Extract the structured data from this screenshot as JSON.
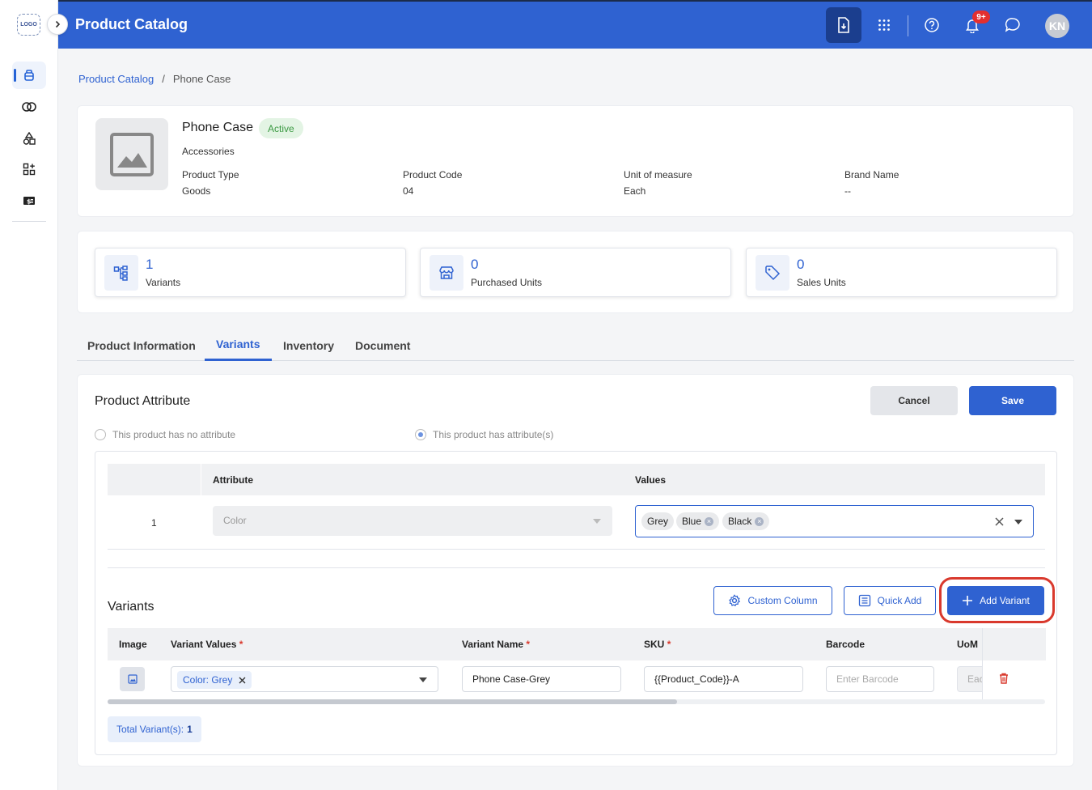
{
  "sidebar": {
    "logo_text": "LOGO",
    "items": [
      {
        "icon": "product-box-icon",
        "active": true
      },
      {
        "icon": "rings-icon",
        "active": false
      },
      {
        "icon": "shapes-icon",
        "active": false
      },
      {
        "icon": "grid-add-icon",
        "active": false
      },
      {
        "icon": "money-icon",
        "active": false
      }
    ]
  },
  "header": {
    "title": "Product Catalog",
    "notification_count": "9+",
    "avatar_initials": "KN"
  },
  "breadcrumb": {
    "parent": "Product Catalog",
    "separator": "/",
    "current": "Phone Case"
  },
  "product": {
    "name": "Phone Case",
    "status": "Active",
    "category": "Accessories",
    "meta": [
      {
        "label": "Product Type",
        "value": "Goods"
      },
      {
        "label": "Product Code",
        "value": "04"
      },
      {
        "label": "Unit of measure",
        "value": "Each"
      },
      {
        "label": "Brand Name",
        "value": "--"
      }
    ]
  },
  "stats": [
    {
      "value": "1",
      "label": "Variants",
      "icon": "hierarchy-icon"
    },
    {
      "value": "0",
      "label": "Purchased Units",
      "icon": "store-icon"
    },
    {
      "value": "0",
      "label": "Sales Units",
      "icon": "tag-icon"
    }
  ],
  "tabs": [
    {
      "label": "Product Information",
      "active": false
    },
    {
      "label": "Variants",
      "active": true
    },
    {
      "label": "Inventory",
      "active": false
    },
    {
      "label": "Document",
      "active": false
    }
  ],
  "attribute_panel": {
    "title": "Product Attribute",
    "cancel_label": "Cancel",
    "save_label": "Save",
    "radio_no_attr": "This product has no attribute",
    "radio_has_attr": "This product has attribute(s)",
    "columns": {
      "attribute": "Attribute",
      "values": "Values"
    },
    "row": {
      "index": "1",
      "attribute": "Color",
      "values": [
        "Grey",
        "Blue",
        "Black"
      ]
    }
  },
  "variants": {
    "title": "Variants",
    "custom_column_label": "Custom Column",
    "quick_add_label": "Quick Add",
    "add_variant_label": "Add Variant",
    "columns": {
      "image": "Image",
      "variant_values": "Variant Values",
      "variant_name": "Variant Name",
      "sku": "SKU",
      "barcode": "Barcode",
      "uom": "UoM",
      "required_mark": "*"
    },
    "row": {
      "variant_value": "Color: Grey",
      "variant_name": "Phone Case-Grey",
      "sku": "{{Product_Code}}-A",
      "barcode_placeholder": "Enter Barcode",
      "uom": "Each"
    },
    "total_label": "Total Variant(s):",
    "total_count": "1"
  },
  "colors": {
    "primary": "#2f62d1",
    "header_bg": "#2f62d1",
    "active_badge_bg": "#e3f4e4",
    "active_badge_text": "#3c9a43",
    "danger": "#d9392d"
  }
}
